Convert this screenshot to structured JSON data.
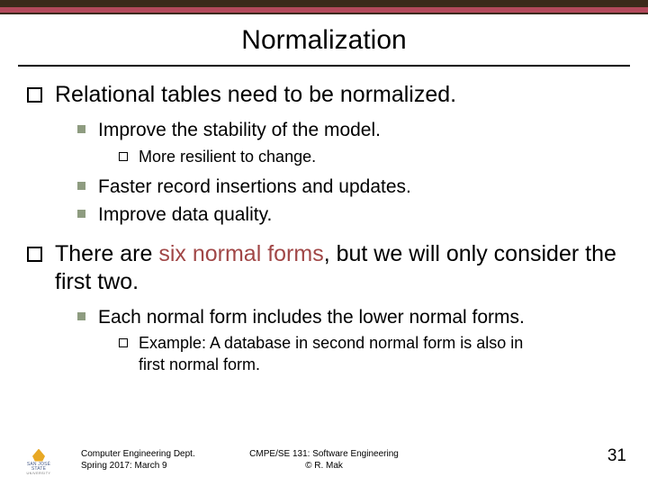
{
  "title": "Normalization",
  "bullets": {
    "b1": {
      "text": "Relational tables need to be normalized.",
      "sub": {
        "s1": {
          "text": "Improve the stability of the model.",
          "sub": {
            "t1": "More resilient to change."
          }
        },
        "s2": "Faster record insertions and updates.",
        "s3": "Improve data quality."
      }
    },
    "b2": {
      "pre": "There are ",
      "accent": "six normal forms",
      "post": ", but we will only consider the first two.",
      "sub": {
        "s1": {
          "text": "Each normal form includes the lower normal forms.",
          "sub": {
            "t1": "Example: A database in second normal form is also in first normal form."
          }
        }
      }
    }
  },
  "footer": {
    "left1": "Computer Engineering Dept.",
    "left2": "Spring 2017: March 9",
    "center1": "CMPE/SE 131: Software Engineering",
    "center2": "© R. Mak",
    "page": "31",
    "logo1": "SAN JOSÉ STATE",
    "logo2": "UNIVERSITY"
  }
}
